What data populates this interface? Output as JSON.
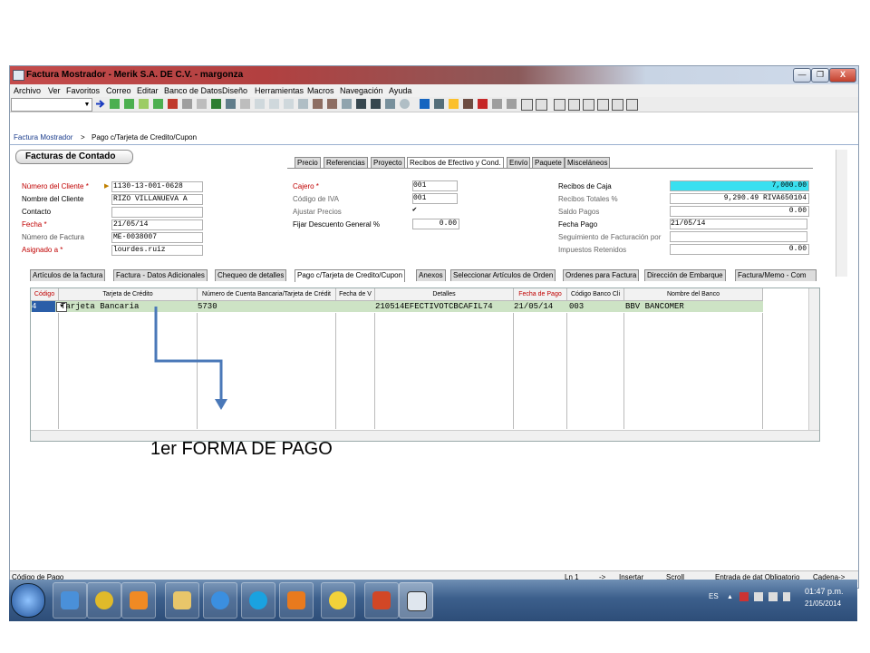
{
  "window": {
    "title": "Factura Mostrador - Merik S.A. DE C.V. - margonza",
    "controls": {
      "minimize": "—",
      "maximize": "❐",
      "close": "X"
    }
  },
  "menubar": [
    "Archivo",
    "Ver",
    "Favoritos",
    "Correo",
    "Editar",
    "Banco de Datos",
    "Diseño",
    "Herramientas",
    "Macros",
    "Navegación",
    "Ayuda"
  ],
  "breadcrumb": {
    "root": "Factura Mostrador",
    "sep": ">",
    "current": "Pago c/Tarjeta de Credito/Cupon"
  },
  "panel_title": "Facturas de Contado",
  "left_fields": [
    {
      "label": "Número del Cliente *",
      "value": "1130-13-001-0628",
      "style": "red"
    },
    {
      "label": "Nombre del Cliente",
      "value": "RIZO VILLANUEVA A",
      "style": "plain"
    },
    {
      "label": "Contacto",
      "value": "",
      "style": "plain"
    },
    {
      "label": "Fecha *",
      "value": "21/05/14",
      "style": "red"
    },
    {
      "label": "Número de Factura",
      "value": "ME-0038007",
      "style": "gray"
    },
    {
      "label": "Asignado a *",
      "value": "lourdes.ruiz",
      "style": "red"
    }
  ],
  "top_tabs": [
    "Precio",
    "Referencias",
    "Proyecto",
    "Recibos de Efectivo y Cond.",
    "Envío",
    "Paquete",
    "Misceláneos"
  ],
  "mid_fields": [
    {
      "label": "Cajero *",
      "value": "001",
      "style": "red"
    },
    {
      "label": "Código de IVA",
      "value": "001",
      "style": "gray"
    },
    {
      "label": "Ajustar Precios",
      "value": "✔",
      "style": "gray"
    },
    {
      "label": "Fijar Descuento General %",
      "value": "0.00",
      "style": "plain"
    }
  ],
  "right_fields": [
    {
      "label": "Recibos de Caja",
      "value": "7,000.00",
      "style": "plain"
    },
    {
      "label": "Recibos Totales %",
      "value": "9,290.49 RIVA650104",
      "style": "gray"
    },
    {
      "label": "Saldo Pagos",
      "value": "0.00",
      "style": "gray"
    },
    {
      "label": "Fecha Pago",
      "value": "21/05/14",
      "style": "plain"
    },
    {
      "label": "Seguimiento de Facturación por",
      "value": "",
      "style": "gray"
    },
    {
      "label": "Impuestos Retenidos",
      "value": "0.00",
      "style": "gray"
    }
  ],
  "bottom_tabs": [
    "Artículos de la factura",
    "Factura - Datos Adicionales",
    "Chequeo de detalles",
    "Pago c/Tarjeta de Credito/Cupon",
    "Anexos",
    "Seleccionar Artículos de Orden",
    "Ordenes para Factura",
    "Dirección de Embarque",
    "Factura/Memo - Com"
  ],
  "grid": {
    "headers": [
      "Código",
      "Tarjeta de Crédito",
      "Número de Cuenta Bancaria/Tarjeta de Crédit",
      "Fecha de V",
      "Detalles",
      "Fecha de Pago",
      "Código Banco Cli",
      "Nombre del Banco"
    ],
    "row": {
      "codigo": "4",
      "tarjeta": "Tarjeta Bancaria",
      "cuenta": "5730",
      "fecha_v": "",
      "detalles": "210514EFECTIVOTCBCAFIL74",
      "fecha_pago": "21/05/14",
      "codigo_banco": "003",
      "banco": "BBV BANCOMER"
    }
  },
  "annotation": "1er FORMA DE PAGO",
  "statusbar": {
    "field": "Código de Pago",
    "line": "Ln 1",
    "arrow": "->",
    "mode": "Insertar",
    "scroll": "Scroll",
    "entry": "Entrada de dat Obligatorio",
    "cadena": "Cadena->"
  },
  "taskbar": {
    "lang": "ES",
    "time": "01:47 p.m.",
    "date": "21/05/2014"
  },
  "colors": {
    "grid_row": "#cde3c5",
    "highlight_field": "#39e0f0",
    "arrow": "#4a78b8"
  }
}
